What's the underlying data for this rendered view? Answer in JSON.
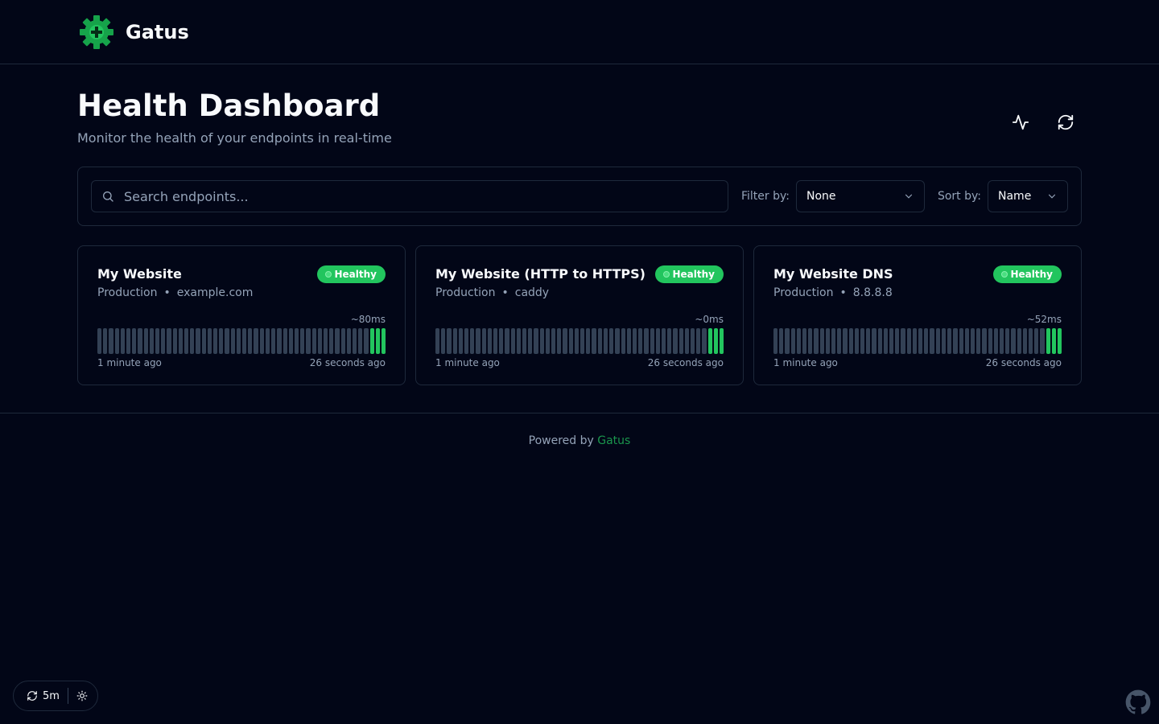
{
  "header": {
    "brand_name": "Gatus",
    "logo_icon": "gear-plus-icon",
    "brand_color": "#22c55e"
  },
  "page": {
    "title": "Health Dashboard",
    "subtitle": "Monitor the health of your endpoints in real-time",
    "actions": [
      {
        "icon": "activity-icon"
      },
      {
        "icon": "refresh-icon"
      }
    ]
  },
  "toolbar": {
    "search_placeholder": "Search endpoints...",
    "filter_label": "Filter by:",
    "filter_value": "None",
    "sort_label": "Sort by:",
    "sort_value": "Name"
  },
  "endpoints": [
    {
      "name": "My Website",
      "group": "Production",
      "host": "example.com",
      "status": "Healthy",
      "response_time": "~80ms",
      "oldest": "1 minute ago",
      "newest": "26 seconds ago",
      "results_total": 50,
      "results_up": 3
    },
    {
      "name": "My Website (HTTP to HTTPS)",
      "group": "Production",
      "host": "caddy",
      "status": "Healthy",
      "response_time": "~0ms",
      "oldest": "1 minute ago",
      "newest": "26 seconds ago",
      "results_total": 50,
      "results_up": 3
    },
    {
      "name": "My Website DNS",
      "group": "Production",
      "host": "8.8.8.8",
      "status": "Healthy",
      "response_time": "~52ms",
      "oldest": "1 minute ago",
      "newest": "26 seconds ago",
      "results_total": 50,
      "results_up": 3
    }
  ],
  "footer": {
    "powered_by": "Powered by",
    "link_text": "Gatus"
  },
  "bottom_controls": {
    "refresh_interval": "5m",
    "refresh_icon": "refresh-icon",
    "theme_icon": "sun-icon",
    "github_icon": "github-icon"
  },
  "colors": {
    "background": "#020617",
    "border": "#1e293b",
    "healthy": "#22c55e",
    "bar_empty": "#334155",
    "muted_text": "#94a3b8"
  }
}
